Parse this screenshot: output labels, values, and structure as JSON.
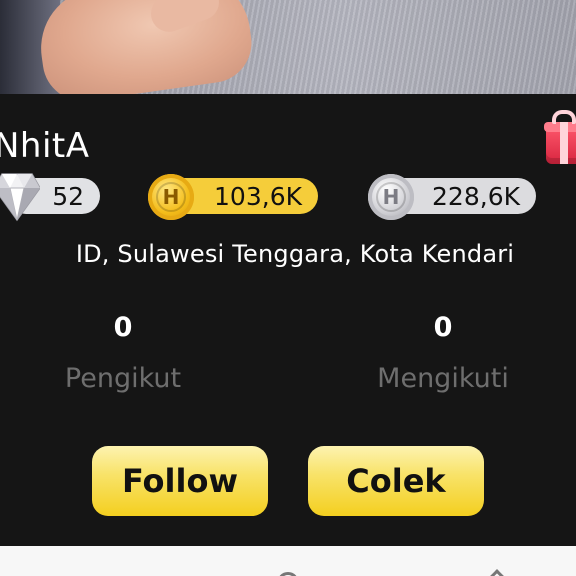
{
  "profile": {
    "username": "NhitA",
    "location": "ID, Sulawesi Tenggara, Kota Kendari"
  },
  "stats": {
    "diamonds": "52",
    "gold_coins": "103,6K",
    "silver_coins": "228,6K"
  },
  "coins": {
    "gold_letter": "H",
    "silver_letter": "H"
  },
  "social": {
    "followers_count": "0",
    "followers_label": "Pengikut",
    "following_count": "0",
    "following_label": "Mengikuti"
  },
  "actions": {
    "follow_label": "Follow",
    "colek_label": "Colek"
  },
  "colors": {
    "background": "#151515",
    "gold_pill": "#f5cd3a",
    "button_yellow": "#f4cf1f",
    "muted_label": "#6e6e6e"
  },
  "icons": [
    "diamond-icon",
    "gold-coin-icon",
    "silver-coin-icon",
    "gift-icon"
  ]
}
